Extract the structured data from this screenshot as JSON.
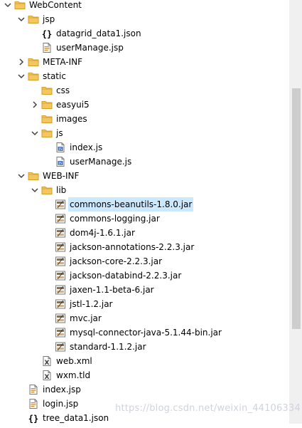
{
  "tree": [
    {
      "label": "WebContent",
      "type": "folder",
      "depth": 0,
      "twisty": "expanded"
    },
    {
      "label": "jsp",
      "type": "folder",
      "depth": 1,
      "twisty": "expanded"
    },
    {
      "label": "datagrid_data1.json",
      "type": "json",
      "depth": 2,
      "twisty": "none"
    },
    {
      "label": "userManage.jsp",
      "type": "jsp",
      "depth": 2,
      "twisty": "none"
    },
    {
      "label": "META-INF",
      "type": "folder",
      "depth": 1,
      "twisty": "collapsed"
    },
    {
      "label": "static",
      "type": "folder",
      "depth": 1,
      "twisty": "expanded"
    },
    {
      "label": "css",
      "type": "folder",
      "depth": 2,
      "twisty": "none"
    },
    {
      "label": "easyui5",
      "type": "folder",
      "depth": 2,
      "twisty": "collapsed"
    },
    {
      "label": "images",
      "type": "folder",
      "depth": 2,
      "twisty": "none"
    },
    {
      "label": "js",
      "type": "folder",
      "depth": 2,
      "twisty": "expanded"
    },
    {
      "label": "index.js",
      "type": "js",
      "depth": 3,
      "twisty": "none"
    },
    {
      "label": "userManage.js",
      "type": "js",
      "depth": 3,
      "twisty": "none"
    },
    {
      "label": "WEB-INF",
      "type": "folder",
      "depth": 1,
      "twisty": "expanded"
    },
    {
      "label": "lib",
      "type": "folder",
      "depth": 2,
      "twisty": "expanded"
    },
    {
      "label": "commons-beanutils-1.8.0.jar",
      "type": "jar",
      "depth": 3,
      "twisty": "none",
      "selected": true
    },
    {
      "label": "commons-logging.jar",
      "type": "jar",
      "depth": 3,
      "twisty": "none"
    },
    {
      "label": "dom4j-1.6.1.jar",
      "type": "jar",
      "depth": 3,
      "twisty": "none"
    },
    {
      "label": "jackson-annotations-2.2.3.jar",
      "type": "jar",
      "depth": 3,
      "twisty": "none"
    },
    {
      "label": "jackson-core-2.2.3.jar",
      "type": "jar",
      "depth": 3,
      "twisty": "none"
    },
    {
      "label": "jackson-databind-2.2.3.jar",
      "type": "jar",
      "depth": 3,
      "twisty": "none"
    },
    {
      "label": "jaxen-1.1-beta-6.jar",
      "type": "jar",
      "depth": 3,
      "twisty": "none"
    },
    {
      "label": "jstl-1.2.jar",
      "type": "jar",
      "depth": 3,
      "twisty": "none"
    },
    {
      "label": "mvc.jar",
      "type": "jar",
      "depth": 3,
      "twisty": "none"
    },
    {
      "label": "mysql-connector-java-5.1.44-bin.jar",
      "type": "jar",
      "depth": 3,
      "twisty": "none"
    },
    {
      "label": "standard-1.1.2.jar",
      "type": "jar",
      "depth": 3,
      "twisty": "none"
    },
    {
      "label": "web.xml",
      "type": "xml",
      "depth": 2,
      "twisty": "none"
    },
    {
      "label": "wxm.tld",
      "type": "xml",
      "depth": 2,
      "twisty": "none"
    },
    {
      "label": "index.jsp",
      "type": "jsp",
      "depth": 1,
      "twisty": "none"
    },
    {
      "label": "login.jsp",
      "type": "jsp",
      "depth": 1,
      "twisty": "none"
    },
    {
      "label": "tree_data1.json",
      "type": "json",
      "depth": 1,
      "twisty": "none"
    }
  ],
  "watermark": "https://blog.csdn.net/weixin_44106334",
  "colors": {
    "folder": "#f4c65d",
    "folder_dark": "#d39f2a",
    "selection": "#cce8ff",
    "twisty": "#404040",
    "jar": "#8b6f47",
    "js_blue": "#3f6fb5"
  }
}
